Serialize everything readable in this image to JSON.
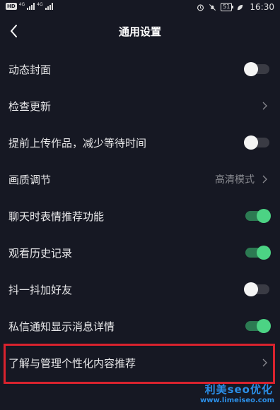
{
  "status_bar": {
    "hd": "HD",
    "net1": "4G",
    "net2": "4G",
    "battery": "51",
    "time": "16:30",
    "icons": [
      "alarm-icon",
      "mute-icon",
      "leaf-icon"
    ]
  },
  "header": {
    "title": "通用设置",
    "back_icon": "chevron-left-icon"
  },
  "rows": [
    {
      "label": "动态封面",
      "kind": "toggle",
      "on": false
    },
    {
      "label": "检查更新",
      "kind": "link"
    },
    {
      "label": "提前上传作品，减少等待时间",
      "kind": "toggle",
      "on": false
    },
    {
      "label": "画质调节",
      "kind": "link",
      "value": "高清模式"
    },
    {
      "label": "聊天时表情推荐功能",
      "kind": "toggle",
      "on": true
    },
    {
      "label": "观看历史记录",
      "kind": "toggle",
      "on": true
    },
    {
      "label": "抖一抖加好友",
      "kind": "toggle",
      "on": false
    },
    {
      "label": "私信通知显示消息详情",
      "kind": "toggle",
      "on": true
    },
    {
      "label": "了解与管理个性化内容推荐",
      "kind": "link"
    }
  ],
  "watermark": {
    "line1": "利美seo优化",
    "line2": "www.limeiseo.com"
  },
  "colors": {
    "background": "#161823",
    "toggle_on": "#4cd384",
    "highlight": "#d9232e",
    "watermark": "#2b8fe8"
  }
}
